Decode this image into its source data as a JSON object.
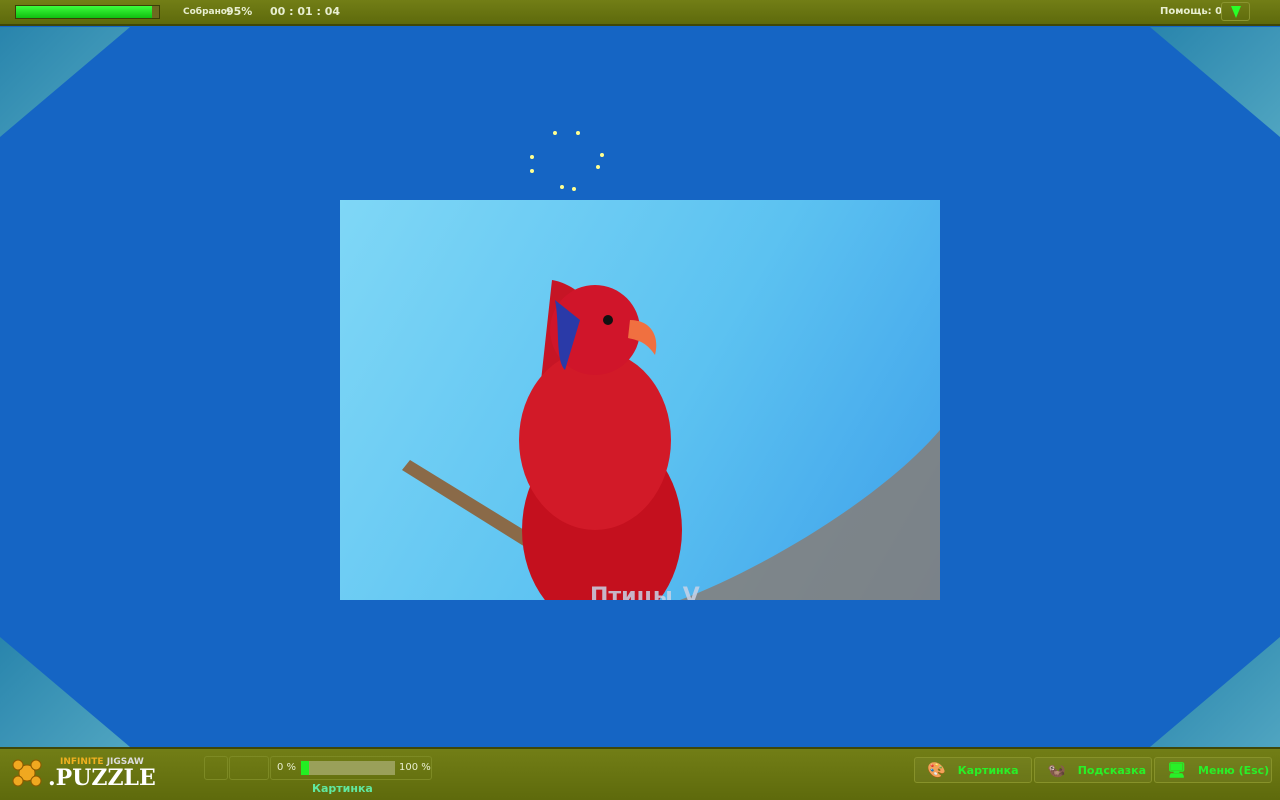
{
  "top": {
    "progress_percent": 95,
    "collected_label": "Собрано:",
    "collected_value": "95%",
    "timer": "00 : 01 : 04",
    "help_label": "Помощь: 0"
  },
  "board": {
    "category": "Птицы",
    "category_arrow": "V"
  },
  "bottom": {
    "logo": "Infinite Jigsaw Puzzle",
    "slider_min": "0 %",
    "slider_max": "100 %",
    "slider_value_percent": 0,
    "slider_caption": "Картинка",
    "buttons": [
      {
        "label": "Картинка",
        "icon": "palette-icon"
      },
      {
        "label": "Подсказка",
        "icon": "hint-icon"
      },
      {
        "label": "Меню (Esc)",
        "icon": "monitor-icon"
      }
    ]
  }
}
